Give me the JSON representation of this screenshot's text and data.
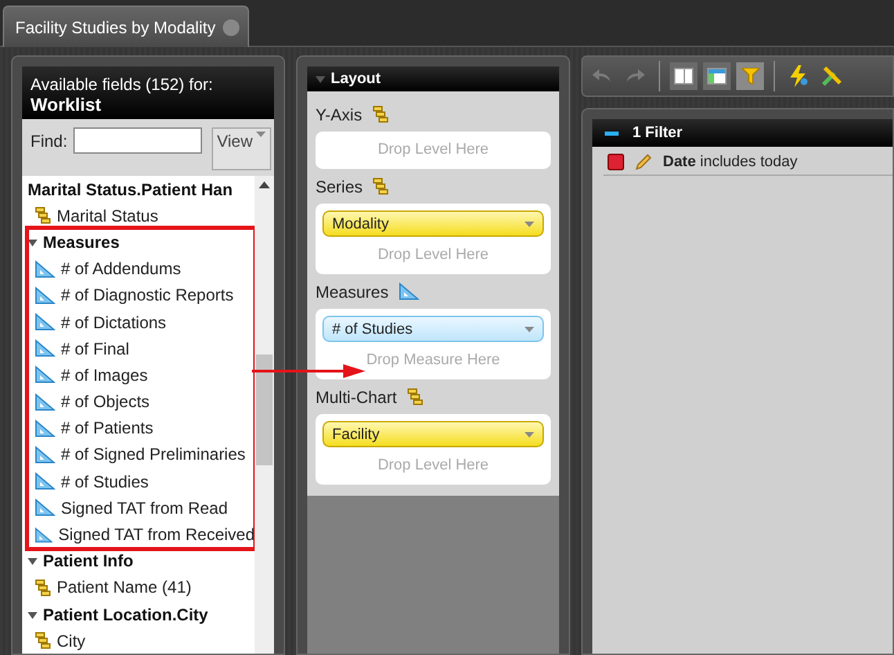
{
  "tab": {
    "title": "Facility Studies by Modality"
  },
  "fields": {
    "title": "Available fields (152) for:",
    "source": "Worklist",
    "find_label": "Find:",
    "view_button": "View",
    "tree": [
      {
        "label": "Marital Status.Patient Han",
        "children": [
          {
            "kind": "level",
            "label": "Marital Status"
          }
        ]
      },
      {
        "label": "Measures",
        "expanded": true,
        "highlighted": true,
        "children": [
          {
            "kind": "measure",
            "label": "# of Addendums"
          },
          {
            "kind": "measure",
            "label": "# of Diagnostic Reports"
          },
          {
            "kind": "measure",
            "label": "# of Dictations"
          },
          {
            "kind": "measure",
            "label": "# of Final"
          },
          {
            "kind": "measure",
            "label": "# of Images"
          },
          {
            "kind": "measure",
            "label": "# of Objects"
          },
          {
            "kind": "measure",
            "label": "# of Patients"
          },
          {
            "kind": "measure",
            "label": "# of Signed Preliminaries"
          },
          {
            "kind": "measure",
            "label": "# of Studies"
          },
          {
            "kind": "measure",
            "label": "Signed TAT from Read"
          },
          {
            "kind": "measure",
            "label": "Signed TAT from Received"
          }
        ]
      },
      {
        "label": "Patient Info",
        "expanded": true,
        "highlighted": false,
        "children": [
          {
            "kind": "level",
            "label": "Patient Name (41)"
          }
        ]
      },
      {
        "label": "Patient Location.City",
        "expanded": true,
        "highlighted": false,
        "children": [
          {
            "kind": "level",
            "label": "City"
          }
        ]
      }
    ]
  },
  "layout": {
    "title": "Layout",
    "expanded": true,
    "sections": [
      {
        "label": "Y-Axis",
        "kind": "level",
        "drop": "Drop Level Here"
      },
      {
        "label": "Series",
        "kind": "level",
        "chips": [
          "Modality"
        ],
        "drop": "Drop Level Here"
      },
      {
        "label": "Measures",
        "kind": "measure",
        "chips": [
          "# of Studies"
        ],
        "drop": "Drop Measure Here",
        "arrow": true
      },
      {
        "label": "Multi-Chart",
        "kind": "level",
        "chips": [
          "Facility"
        ],
        "drop": "Drop Level Here"
      }
    ]
  },
  "toolbar": [
    {
      "kind": "undo",
      "disabled": true
    },
    {
      "kind": "redo",
      "disabled": true
    },
    {
      "kind": "separator"
    },
    {
      "kind": "columns",
      "selected": false
    },
    {
      "kind": "layout",
      "selected": false
    },
    {
      "kind": "filter",
      "selected": true
    },
    {
      "kind": "separator"
    },
    {
      "kind": "lightning"
    },
    {
      "kind": "tools"
    }
  ],
  "filters": {
    "title": "1 Filter",
    "expanded": true,
    "items": [
      "**Date** includes today"
    ]
  }
}
